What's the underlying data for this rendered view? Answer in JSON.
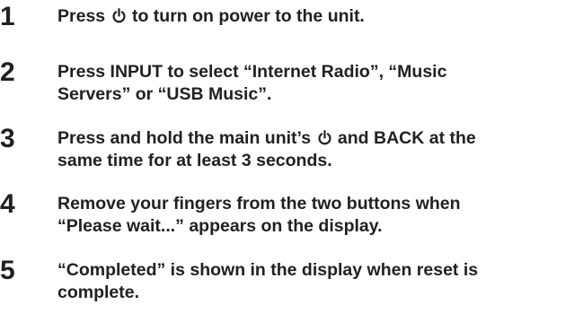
{
  "steps": [
    {
      "number": "1",
      "lines": [
        {
          "before": "Press ",
          "icon": "power-icon",
          "after": " to turn on power to the unit."
        }
      ]
    },
    {
      "number": "2",
      "lines": [
        {
          "text": "Press INPUT to select “Internet Radio”, “Music"
        },
        {
          "text": "Servers” or “USB Music”."
        }
      ]
    },
    {
      "number": "3",
      "lines": [
        {
          "before": "Press and hold the main unit’s ",
          "icon": "power-icon",
          "after": " and BACK at the"
        },
        {
          "text": "same time for at least 3 seconds."
        }
      ]
    },
    {
      "number": "4",
      "lines": [
        {
          "text": "Remove your fingers from the two buttons when"
        },
        {
          "text": "“Please wait...” appears on the display."
        }
      ]
    },
    {
      "number": "5",
      "lines": [
        {
          "text": "“Completed” is shown in the display when reset is"
        },
        {
          "text": "complete."
        }
      ]
    }
  ]
}
